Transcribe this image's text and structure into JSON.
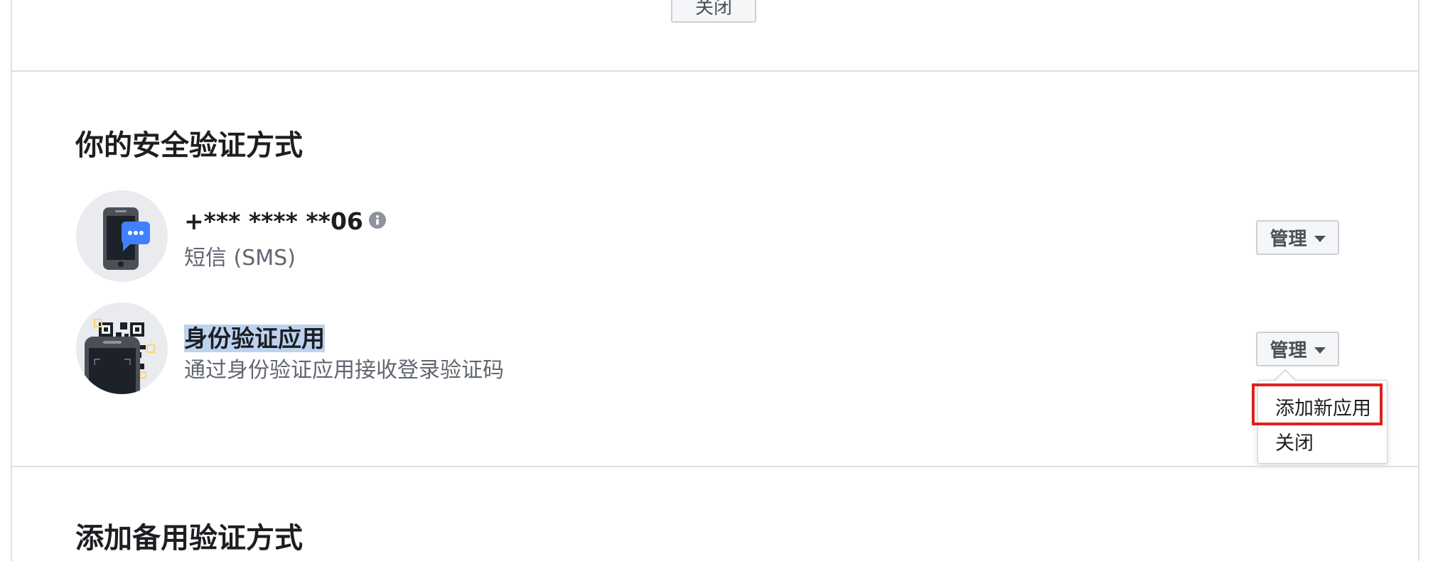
{
  "top": {
    "close_label": "关闭"
  },
  "methods_section": {
    "title": "你的安全验证方式",
    "items": [
      {
        "title": "+*** **** **06",
        "subtitle": "短信 (SMS)",
        "icon": "phone-sms-icon",
        "manage_label": "管理"
      },
      {
        "title": "身份验证应用",
        "subtitle": "通过身份验证应用接收登录验证码",
        "icon": "qr-phone-icon",
        "manage_label": "管理"
      }
    ]
  },
  "dropdown": {
    "items": [
      "添加新应用",
      "关闭"
    ]
  },
  "backup_section": {
    "title": "添加备用验证方式"
  },
  "colors": {
    "accent": "#4080ff",
    "highlight": "#bcd3f0",
    "border": "#dddfe2",
    "annotation": "#e02020"
  }
}
